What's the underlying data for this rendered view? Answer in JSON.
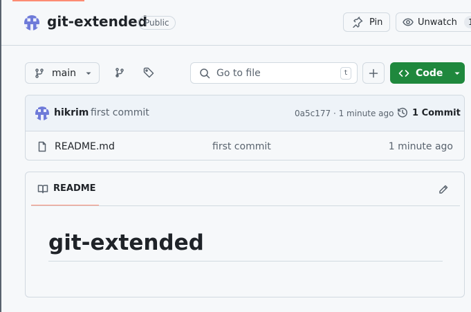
{
  "repo": {
    "name": "git-extended",
    "visibility": "Public"
  },
  "header": {
    "pin_label": "Pin",
    "watch_label": "Unwatch",
    "watch_count": "1"
  },
  "toolbar": {
    "branch": "main",
    "search_placeholder": "Go to file",
    "search_shortcut": "t",
    "code_label": "Code"
  },
  "latest_commit": {
    "author": "hikrim",
    "message": "first commit",
    "meta": "0a5c177 · 1 minute ago",
    "commits_label": "1 Commit"
  },
  "files": [
    {
      "name": "README.md",
      "commit_message": "first commit",
      "age": "1 minute ago"
    }
  ],
  "readme": {
    "tab_label": "README",
    "heading": "git-extended"
  },
  "colors": {
    "accent_underline": "#fd8c73",
    "code_button": "#1f883d",
    "avatar": "#6f7bd9"
  },
  "icons": [
    "pin-icon",
    "eye-icon",
    "git-branch-icon",
    "chevron-down-icon",
    "branches-icon",
    "tag-icon",
    "search-icon",
    "plus-icon",
    "code-icon",
    "history-icon",
    "file-icon",
    "book-icon",
    "pencil-icon"
  ]
}
